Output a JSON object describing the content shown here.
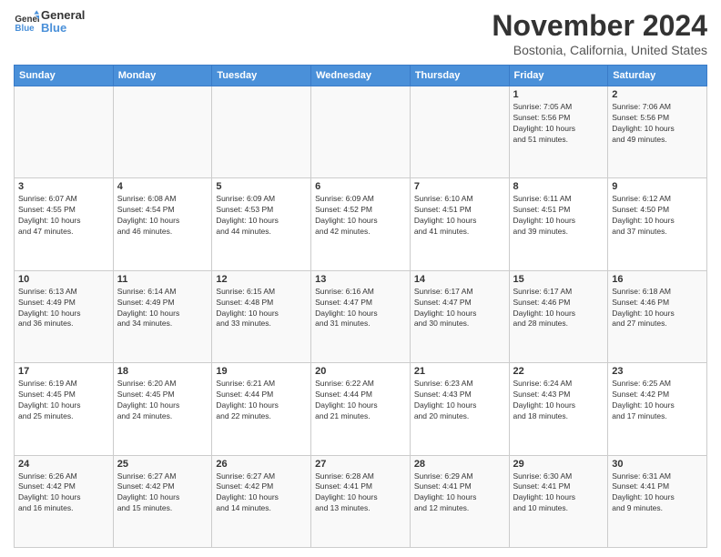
{
  "header": {
    "logo_line1": "General",
    "logo_line2": "Blue",
    "title": "November 2024",
    "subtitle": "Bostonia, California, United States"
  },
  "days_of_week": [
    "Sunday",
    "Monday",
    "Tuesday",
    "Wednesday",
    "Thursday",
    "Friday",
    "Saturday"
  ],
  "weeks": [
    [
      {
        "num": "",
        "info": ""
      },
      {
        "num": "",
        "info": ""
      },
      {
        "num": "",
        "info": ""
      },
      {
        "num": "",
        "info": ""
      },
      {
        "num": "",
        "info": ""
      },
      {
        "num": "1",
        "info": "Sunrise: 7:05 AM\nSunset: 5:56 PM\nDaylight: 10 hours\nand 51 minutes."
      },
      {
        "num": "2",
        "info": "Sunrise: 7:06 AM\nSunset: 5:56 PM\nDaylight: 10 hours\nand 49 minutes."
      }
    ],
    [
      {
        "num": "3",
        "info": "Sunrise: 6:07 AM\nSunset: 4:55 PM\nDaylight: 10 hours\nand 47 minutes."
      },
      {
        "num": "4",
        "info": "Sunrise: 6:08 AM\nSunset: 4:54 PM\nDaylight: 10 hours\nand 46 minutes."
      },
      {
        "num": "5",
        "info": "Sunrise: 6:09 AM\nSunset: 4:53 PM\nDaylight: 10 hours\nand 44 minutes."
      },
      {
        "num": "6",
        "info": "Sunrise: 6:09 AM\nSunset: 4:52 PM\nDaylight: 10 hours\nand 42 minutes."
      },
      {
        "num": "7",
        "info": "Sunrise: 6:10 AM\nSunset: 4:51 PM\nDaylight: 10 hours\nand 41 minutes."
      },
      {
        "num": "8",
        "info": "Sunrise: 6:11 AM\nSunset: 4:51 PM\nDaylight: 10 hours\nand 39 minutes."
      },
      {
        "num": "9",
        "info": "Sunrise: 6:12 AM\nSunset: 4:50 PM\nDaylight: 10 hours\nand 37 minutes."
      }
    ],
    [
      {
        "num": "10",
        "info": "Sunrise: 6:13 AM\nSunset: 4:49 PM\nDaylight: 10 hours\nand 36 minutes."
      },
      {
        "num": "11",
        "info": "Sunrise: 6:14 AM\nSunset: 4:49 PM\nDaylight: 10 hours\nand 34 minutes."
      },
      {
        "num": "12",
        "info": "Sunrise: 6:15 AM\nSunset: 4:48 PM\nDaylight: 10 hours\nand 33 minutes."
      },
      {
        "num": "13",
        "info": "Sunrise: 6:16 AM\nSunset: 4:47 PM\nDaylight: 10 hours\nand 31 minutes."
      },
      {
        "num": "14",
        "info": "Sunrise: 6:17 AM\nSunset: 4:47 PM\nDaylight: 10 hours\nand 30 minutes."
      },
      {
        "num": "15",
        "info": "Sunrise: 6:17 AM\nSunset: 4:46 PM\nDaylight: 10 hours\nand 28 minutes."
      },
      {
        "num": "16",
        "info": "Sunrise: 6:18 AM\nSunset: 4:46 PM\nDaylight: 10 hours\nand 27 minutes."
      }
    ],
    [
      {
        "num": "17",
        "info": "Sunrise: 6:19 AM\nSunset: 4:45 PM\nDaylight: 10 hours\nand 25 minutes."
      },
      {
        "num": "18",
        "info": "Sunrise: 6:20 AM\nSunset: 4:45 PM\nDaylight: 10 hours\nand 24 minutes."
      },
      {
        "num": "19",
        "info": "Sunrise: 6:21 AM\nSunset: 4:44 PM\nDaylight: 10 hours\nand 22 minutes."
      },
      {
        "num": "20",
        "info": "Sunrise: 6:22 AM\nSunset: 4:44 PM\nDaylight: 10 hours\nand 21 minutes."
      },
      {
        "num": "21",
        "info": "Sunrise: 6:23 AM\nSunset: 4:43 PM\nDaylight: 10 hours\nand 20 minutes."
      },
      {
        "num": "22",
        "info": "Sunrise: 6:24 AM\nSunset: 4:43 PM\nDaylight: 10 hours\nand 18 minutes."
      },
      {
        "num": "23",
        "info": "Sunrise: 6:25 AM\nSunset: 4:42 PM\nDaylight: 10 hours\nand 17 minutes."
      }
    ],
    [
      {
        "num": "24",
        "info": "Sunrise: 6:26 AM\nSunset: 4:42 PM\nDaylight: 10 hours\nand 16 minutes."
      },
      {
        "num": "25",
        "info": "Sunrise: 6:27 AM\nSunset: 4:42 PM\nDaylight: 10 hours\nand 15 minutes."
      },
      {
        "num": "26",
        "info": "Sunrise: 6:27 AM\nSunset: 4:42 PM\nDaylight: 10 hours\nand 14 minutes."
      },
      {
        "num": "27",
        "info": "Sunrise: 6:28 AM\nSunset: 4:41 PM\nDaylight: 10 hours\nand 13 minutes."
      },
      {
        "num": "28",
        "info": "Sunrise: 6:29 AM\nSunset: 4:41 PM\nDaylight: 10 hours\nand 12 minutes."
      },
      {
        "num": "29",
        "info": "Sunrise: 6:30 AM\nSunset: 4:41 PM\nDaylight: 10 hours\nand 10 minutes."
      },
      {
        "num": "30",
        "info": "Sunrise: 6:31 AM\nSunset: 4:41 PM\nDaylight: 10 hours\nand 9 minutes."
      }
    ]
  ]
}
